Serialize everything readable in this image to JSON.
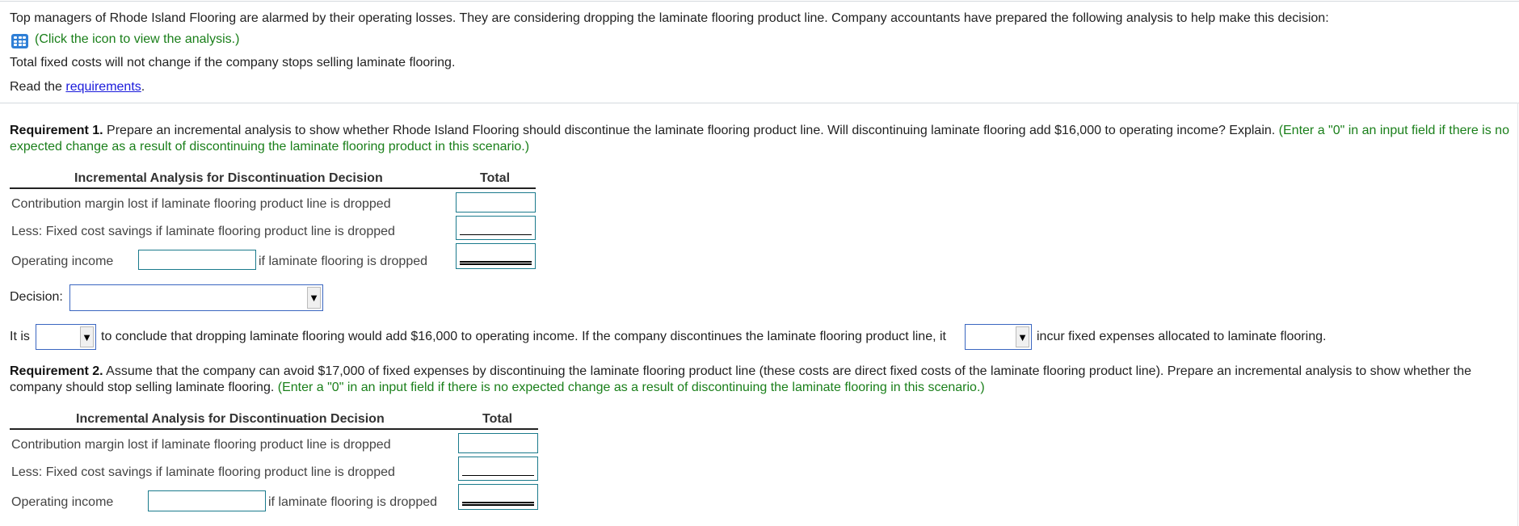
{
  "intro": {
    "problem_text": "Top managers of Rhode Island Flooring are alarmed by their operating losses. They are considering dropping the laminate flooring product line. Company accountants have prepared the following analysis to help make this decision:",
    "icon_hint": "(Click the icon to view the analysis.)",
    "icon": "spreadsheet-grid-icon",
    "fixed_costs_note": "Total fixed costs will not change if the company stops selling laminate flooring.",
    "read_prefix": "Read the ",
    "requirements_link": "requirements",
    "read_suffix": "."
  },
  "requirement1": {
    "label": "Requirement 1.",
    "text": " Prepare an incremental analysis to show whether Rhode Island Flooring should discontinue the laminate flooring product line. Will discontinuing laminate flooring add $16,000 to operating income? Explain. ",
    "hint": "(Enter a \"0\" in an input field if there is no expected change as a result of discontinuing the laminate flooring product in this scenario.)",
    "table": {
      "title": "Incremental Analysis for Discontinuation Decision",
      "total_header": "Total",
      "rows": [
        {
          "label": "Contribution margin lost if laminate flooring product line is dropped",
          "value": ""
        },
        {
          "label": "Less: Fixed cost savings if laminate flooring product line is dropped",
          "value": ""
        },
        {
          "label": "Operating income",
          "middle_value": "",
          "suffix": "if laminate flooring is dropped",
          "value": ""
        }
      ]
    },
    "decision_label": "Decision:",
    "decision_value": "",
    "sentence": {
      "part1": "It is",
      "select1_value": "",
      "part2": "to conclude that dropping laminate flooring would add $16,000 to operating income. If the company discontinues the laminate flooring product line, it",
      "select2_value": "",
      "part3": "incur fixed expenses allocated to laminate flooring."
    }
  },
  "requirement2": {
    "label": "Requirement 2.",
    "text": " Assume that the company can avoid $17,000 of fixed expenses by discontinuing the laminate flooring product line (these costs are direct fixed costs of the laminate flooring product line). Prepare an incremental analysis to show whether the company should stop selling laminate flooring. ",
    "hint": "(Enter a \"0\" in an input field if there is no expected change as a result of discontinuing  the laminate flooring in this scenario.)",
    "table": {
      "title": "Incremental Analysis for Discontinuation Decision",
      "total_header": "Total",
      "rows": [
        {
          "label": "Contribution margin lost if laminate flooring product line is dropped",
          "value": ""
        },
        {
          "label": "Less: Fixed cost savings if laminate flooring product line is dropped",
          "value": ""
        },
        {
          "label": "Operating income",
          "middle_value": "",
          "suffix": "if laminate flooring is dropped",
          "value": ""
        }
      ]
    }
  },
  "colors": {
    "hint_green": "#1a7f1a",
    "link_blue": "#1a1adb",
    "input_border": "#1a7a8c",
    "select_border": "#3a66c0",
    "icon_blue": "#2f7fd6"
  }
}
